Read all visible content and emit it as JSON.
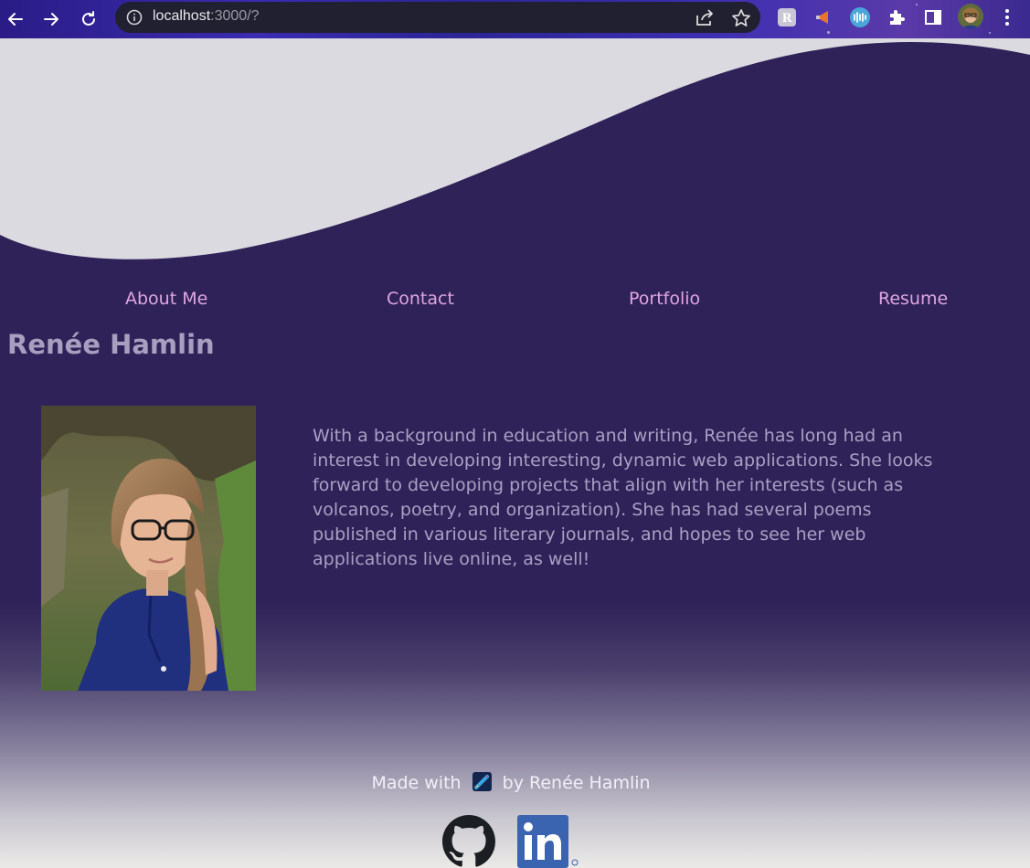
{
  "browser": {
    "url_host": "localhost",
    "url_rest": ":3000/?",
    "icons": [
      "back-icon",
      "forward-icon",
      "reload-icon",
      "site-info-icon",
      "share-icon",
      "bookmark-star-icon",
      "extension-r-icon",
      "extension-megaphone-icon",
      "extension-audio-icon",
      "extensions-puzzle-icon",
      "side-panel-icon",
      "profile-avatar",
      "menu-dots-icon"
    ]
  },
  "nav": {
    "items": [
      {
        "label": "About Me"
      },
      {
        "label": "Contact"
      },
      {
        "label": "Portfolio"
      },
      {
        "label": "Resume"
      }
    ]
  },
  "main": {
    "name": "Renée Hamlin",
    "bio": "With a background in education and writing, Renée has long had an interest in developing interesting, dynamic web applications. She looks forward to developing projects that align with her interests (such as volcanos, poetry, and organization). She has had several poems published in various literary journals, and hopes to see her web applications live online, as well!"
  },
  "footer": {
    "made_with": "Made with",
    "by_text": "by Renée Hamlin",
    "icons": [
      "rocket-icon",
      "github-icon",
      "linkedin-icon"
    ]
  },
  "colors": {
    "background": "#2f2258",
    "wave_light": "#dcdae1",
    "nav_link": "#dfa6e0",
    "heading": "#a79fc0",
    "body_text": "#a9a0c4"
  }
}
